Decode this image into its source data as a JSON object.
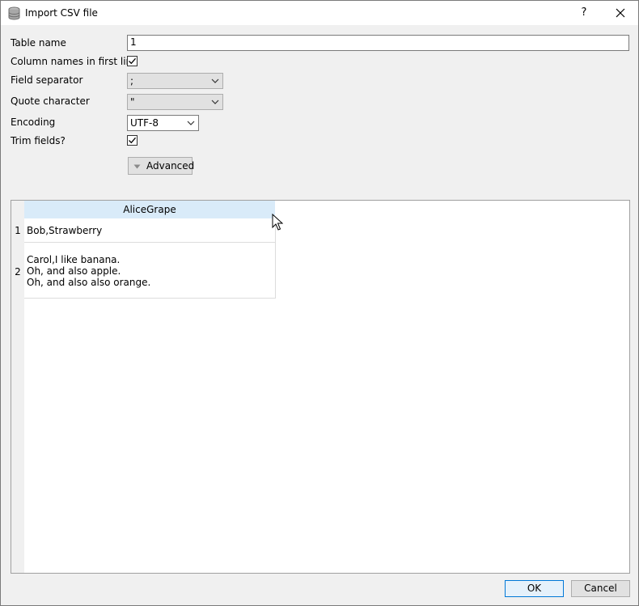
{
  "window": {
    "title": "Import CSV file",
    "help_label": "?"
  },
  "form": {
    "table_name": {
      "label": "Table name",
      "value": "1"
    },
    "column_names": {
      "label": "Column names in first line",
      "checked": true
    },
    "field_separator": {
      "label": "Field separator",
      "value": ";"
    },
    "quote_character": {
      "label": "Quote character",
      "value": "\""
    },
    "encoding": {
      "label": "Encoding",
      "value": "UTF-8"
    },
    "trim_fields": {
      "label": "Trim fields?",
      "checked": true
    },
    "advanced_label": "Advanced"
  },
  "preview": {
    "columns": [
      "AliceGrape"
    ],
    "rows": [
      {
        "num": "1",
        "lines": [
          "Bob,Strawberry"
        ]
      },
      {
        "num": "2",
        "lines": [
          "Carol,I like banana.",
          "Oh, and also apple.",
          "Oh, and also also orange."
        ]
      }
    ]
  },
  "buttons": {
    "ok": "OK",
    "cancel": "Cancel"
  },
  "colors": {
    "header_bg": "#d9ebf9",
    "default_button_border": "#0078d7"
  },
  "icons": {
    "app": "database-icon",
    "close": "close-icon",
    "dropdown": "chevron-down-icon",
    "check": "checkmark-icon",
    "advanced": "triangle-down-icon",
    "cursor": "mouse-pointer-icon"
  }
}
